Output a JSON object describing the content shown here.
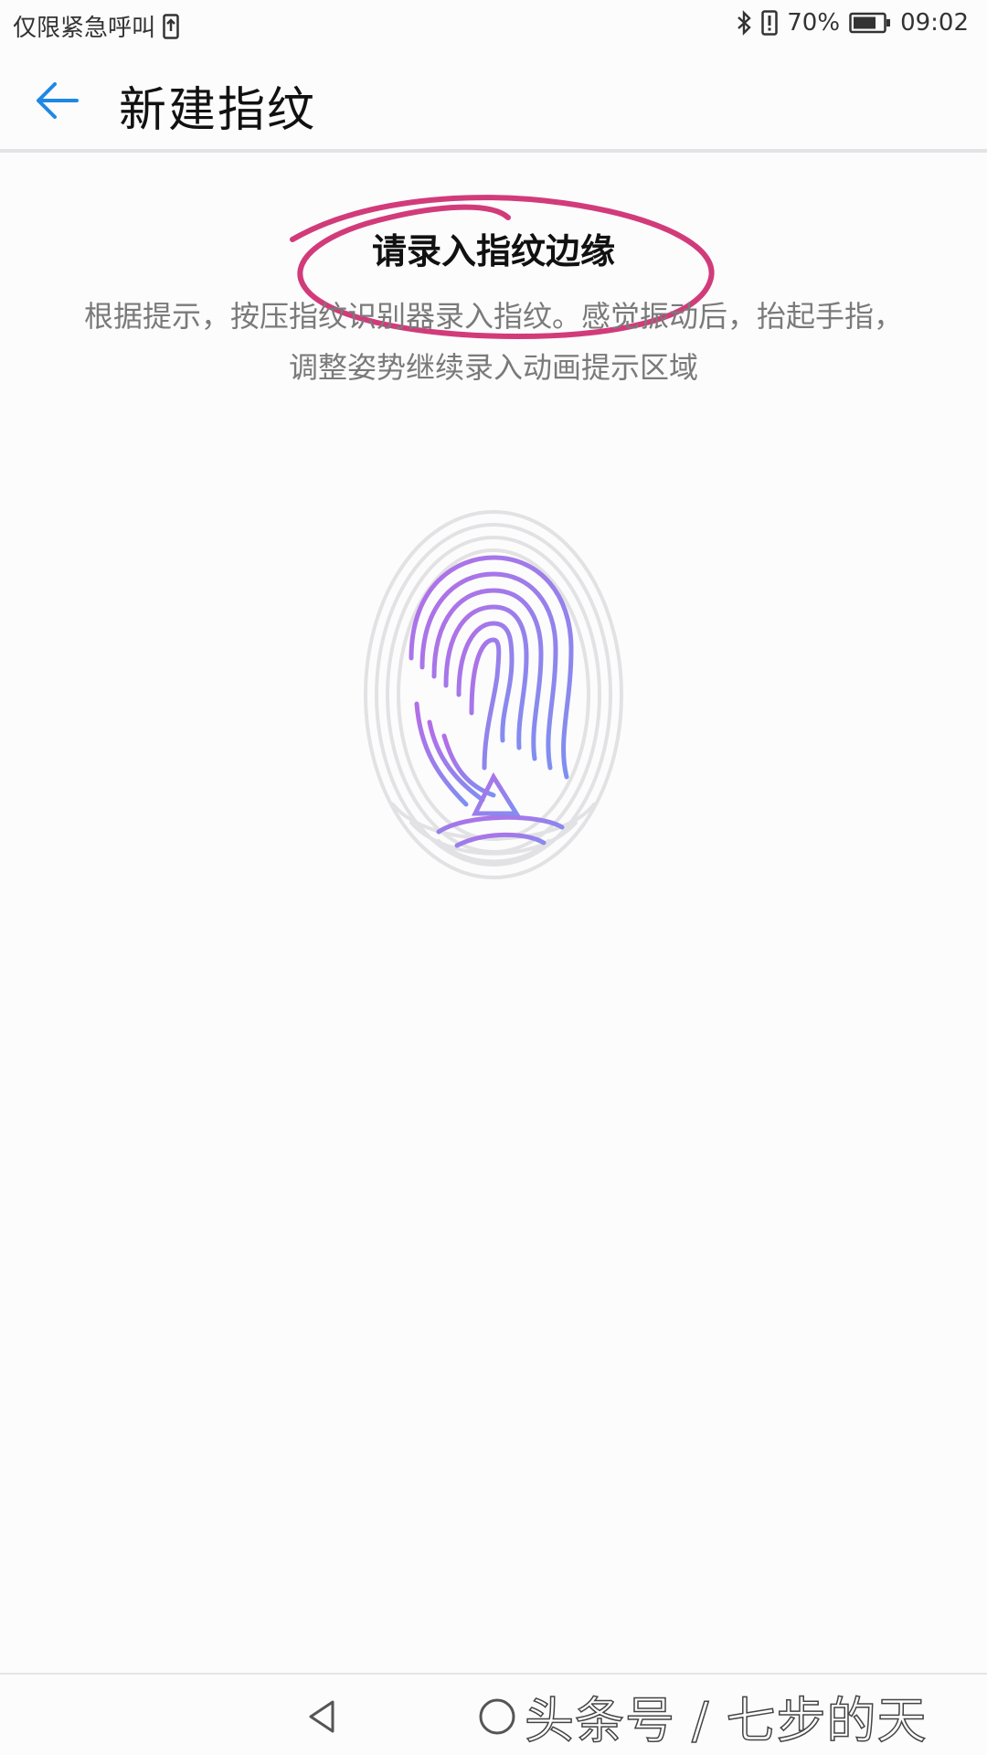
{
  "status_bar": {
    "carrier": "仅限紧急呼叫",
    "battery_percent": "70%",
    "time": "09:02",
    "icons": [
      "sim-upload-icon",
      "bluetooth-icon",
      "alert-icon",
      "battery-icon"
    ]
  },
  "app_bar": {
    "title": "新建指纹",
    "back_icon": "arrow-left-icon",
    "accent_color": "#1e88e5"
  },
  "content": {
    "instruction_title": "请录入指纹边缘",
    "instruction_line1": "根据提示，按压指纹识别器录入指纹。感觉振动后，抬起手指，",
    "instruction_line2": "调整姿势继续录入动画提示区域",
    "annotation_color": "#d23b7a",
    "fingerprint_gradient": [
      "#b46ee6",
      "#7f8ff0"
    ]
  },
  "nav_bar": {
    "icons": [
      "nav-back-icon",
      "nav-home-icon"
    ],
    "watermark": "头条号 / 七步的天"
  }
}
